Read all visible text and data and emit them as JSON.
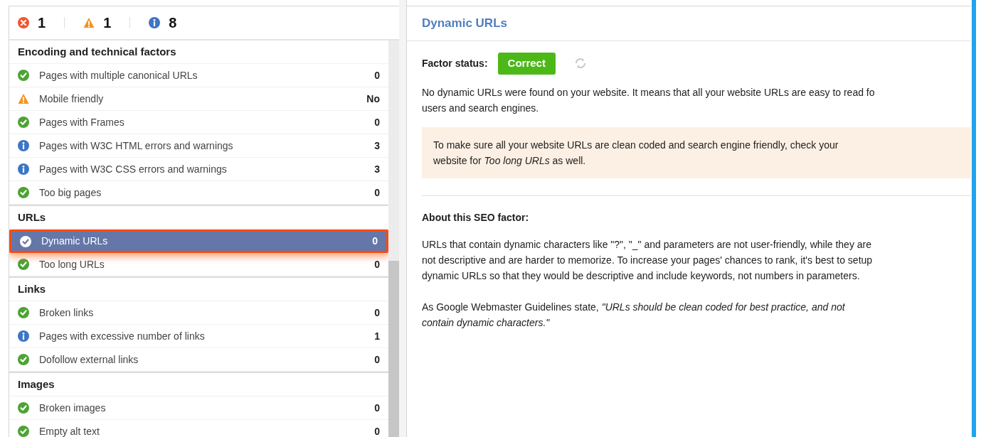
{
  "summary": [
    {
      "kind": "error",
      "count": "1"
    },
    {
      "kind": "warning",
      "count": "1"
    },
    {
      "kind": "info",
      "count": "8"
    }
  ],
  "groups": [
    {
      "title": "Encoding and technical factors",
      "items": [
        {
          "label": "Pages with multiple canonical URLs",
          "value": "0",
          "kind": "ok",
          "selected": false
        },
        {
          "label": "Mobile friendly",
          "value": "No",
          "kind": "warning",
          "selected": false
        },
        {
          "label": "Pages with Frames",
          "value": "0",
          "kind": "ok",
          "selected": false
        },
        {
          "label": "Pages with W3C HTML errors and warnings",
          "value": "3",
          "kind": "info",
          "selected": false
        },
        {
          "label": "Pages with W3C CSS errors and warnings",
          "value": "3",
          "kind": "info",
          "selected": false
        },
        {
          "label": "Too big pages",
          "value": "0",
          "kind": "ok",
          "selected": false
        }
      ]
    },
    {
      "title": "URLs",
      "items": [
        {
          "label": "Dynamic URLs",
          "value": "0",
          "kind": "ok",
          "selected": true
        },
        {
          "label": "Too long URLs",
          "value": "0",
          "kind": "ok",
          "selected": false
        }
      ]
    },
    {
      "title": "Links",
      "items": [
        {
          "label": "Broken links",
          "value": "0",
          "kind": "ok",
          "selected": false
        },
        {
          "label": "Pages with excessive number of links",
          "value": "1",
          "kind": "info",
          "selected": false
        },
        {
          "label": "Dofollow external links",
          "value": "0",
          "kind": "ok",
          "selected": false
        }
      ]
    },
    {
      "title": "Images",
      "items": [
        {
          "label": "Broken images",
          "value": "0",
          "kind": "ok",
          "selected": false
        },
        {
          "label": "Empty alt text",
          "value": "0",
          "kind": "ok",
          "selected": false
        }
      ]
    }
  ],
  "detail": {
    "title": "Dynamic URLs",
    "status_label": "Factor status:",
    "status": "Correct",
    "intro": [
      "No dynamic URLs were found on your website. It means that all your website URLs are easy to read fo",
      "users and search engines."
    ],
    "note": [
      "To make sure all your website URLs are clean coded and search engine friendly, check your",
      "website for *Too long URLs* as well."
    ],
    "about_title": "About this SEO factor:",
    "about": [
      "URLs that contain dynamic characters like \"?\", \"_\" and parameters are not user-friendly, while they are",
      "not descriptive and are harder to memorize. To increase your pages' chances to rank, it's best to setup",
      "dynamic URLs so that they would be descriptive and include keywords, not numbers in parameters."
    ],
    "quote": [
      "As Google Webmaster Guidelines state, *\"URLs should be clean coded for best practice, and not*",
      "*contain dynamic characters.\"*"
    ]
  }
}
